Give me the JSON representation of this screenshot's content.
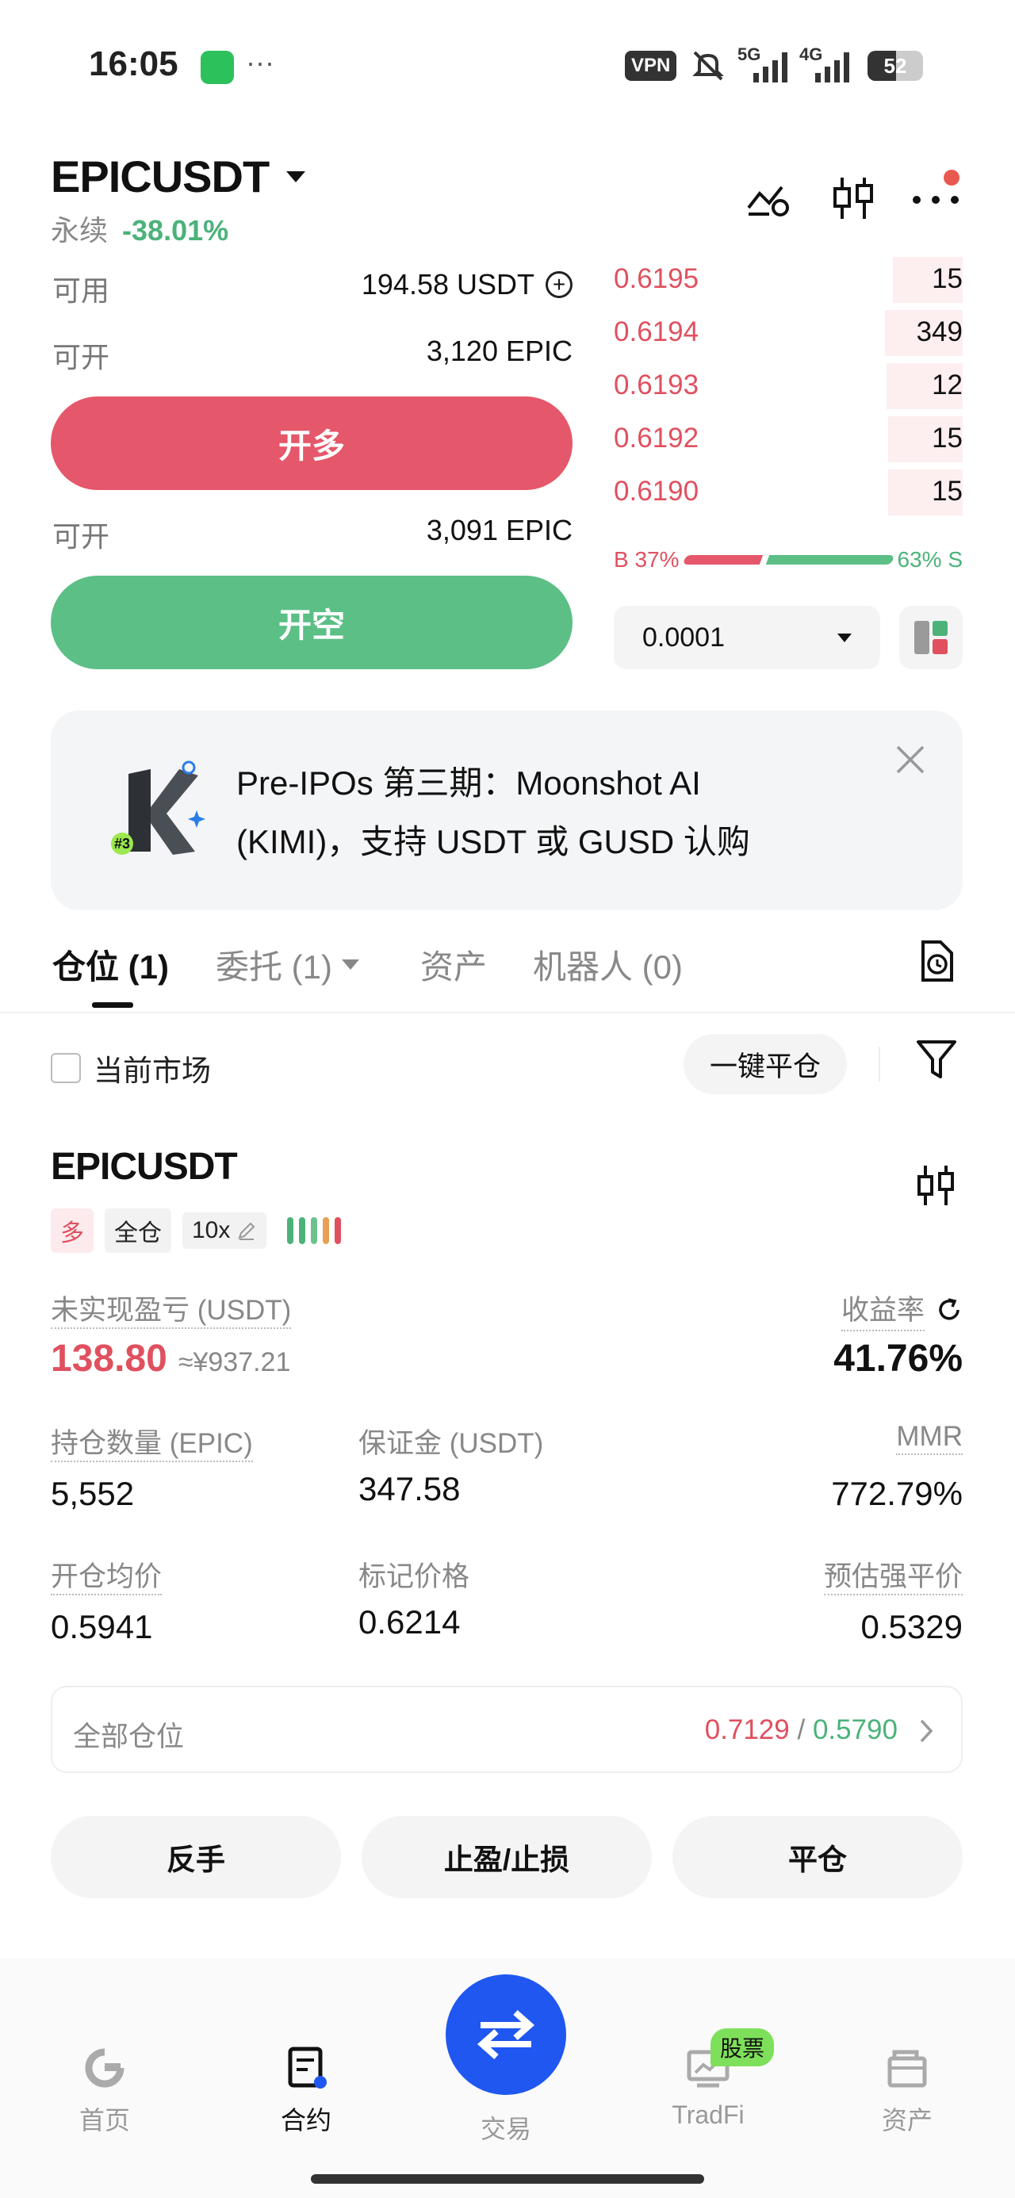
{
  "status_bar": {
    "time": "16:05",
    "more": "···",
    "vpn": "VPN",
    "net1": "5G",
    "net2": "4G",
    "battery": "52"
  },
  "header": {
    "symbol": "EPICUSDT",
    "type": "永续",
    "change": "-38.01%"
  },
  "trade": {
    "available_label": "可用",
    "available_value": "194.58 USDT",
    "open_long_label": "可开",
    "open_long_value": "3,120 EPIC",
    "long_button": "开多",
    "open_short_label": "可开",
    "open_short_value": "3,091 EPIC",
    "short_button": "开空"
  },
  "orderbook": {
    "asks": [
      {
        "price": "0.6195",
        "qty": "15"
      },
      {
        "price": "0.6194",
        "qty": "349"
      },
      {
        "price": "0.6193",
        "qty": "12"
      },
      {
        "price": "0.6192",
        "qty": "15"
      },
      {
        "price": "0.6190",
        "qty": "15"
      }
    ],
    "buy_ratio": "B 37%",
    "sell_ratio": "63% S",
    "buy_fraction": 0.37,
    "precision": "0.0001"
  },
  "banner": {
    "line1": "Pre-IPOs 第三期：Moonshot AI",
    "line2": "(KIMI)，支持 USDT 或 GUSD 认购",
    "badge": "#3"
  },
  "tabs": [
    {
      "label": "仓位 (1)"
    },
    {
      "label": "委托 (1)"
    },
    {
      "label": "资产"
    },
    {
      "label": "机器人 (0)"
    }
  ],
  "filter": {
    "current_market": "当前市场",
    "close_all": "一键平仓"
  },
  "position": {
    "symbol": "EPICUSDT",
    "side": "多",
    "margin_mode": "全仓",
    "leverage": "10x",
    "unrealized_label": "未实现盈亏 (USDT)",
    "unrealized_value": "138.80",
    "unrealized_cny": "≈¥937.21",
    "roe_label": "收益率",
    "roe_value": "41.76%",
    "qty_label": "持仓数量 (EPIC)",
    "qty_value": "5,552",
    "margin_label": "保证金 (USDT)",
    "margin_value": "347.58",
    "mmr_label": "MMR",
    "mmr_value": "772.79%",
    "entry_label": "开仓均价",
    "entry_value": "0.5941",
    "mark_label": "标记价格",
    "mark_value": "0.6214",
    "liq_label": "预估强平价",
    "liq_value": "0.5329",
    "all_positions_label": "全部仓位",
    "all_high": "0.7129",
    "all_sep": " / ",
    "all_low": "0.5790",
    "btn_reverse": "反手",
    "btn_tpsl": "止盈/止损",
    "btn_close": "平仓"
  },
  "nav": [
    {
      "label": "首页"
    },
    {
      "label": "合约"
    },
    {
      "label": "交易"
    },
    {
      "label": "TradFi"
    },
    {
      "label": "资产"
    }
  ],
  "nav_badge": "股票",
  "colors": {
    "red": "#e0505f",
    "green": "#4cb27a",
    "blue": "#1f57f0",
    "orange": "#e8a056"
  }
}
